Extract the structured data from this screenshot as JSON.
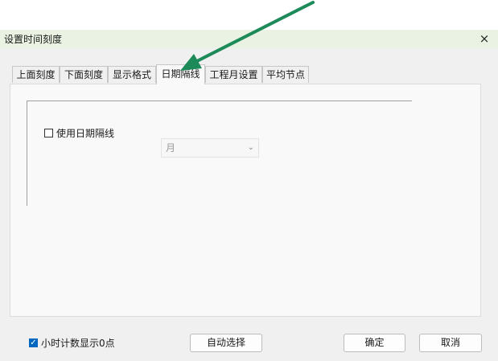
{
  "window": {
    "title": "设置时间刻度",
    "close_icon": "×"
  },
  "tabs": [
    {
      "label": "上面刻度",
      "active": false
    },
    {
      "label": "下面刻度",
      "active": false
    },
    {
      "label": "显示格式",
      "active": false
    },
    {
      "label": "日期隔线",
      "active": true
    },
    {
      "label": "工程月设置",
      "active": false
    },
    {
      "label": "平均节点",
      "active": false
    }
  ],
  "date_line": {
    "checkbox_label": "使用日期隔线",
    "checked": false,
    "select_value": "月",
    "select_enabled": false
  },
  "footer": {
    "show_zero_label": "小时计数显示0点",
    "show_zero_checked": true,
    "auto_select_label": "自动选择",
    "ok_label": "确定",
    "cancel_label": "取消"
  },
  "colors": {
    "arrow": "#1d8a5a",
    "titlebar": "#eaf3e3",
    "accent": "#0067c0"
  }
}
